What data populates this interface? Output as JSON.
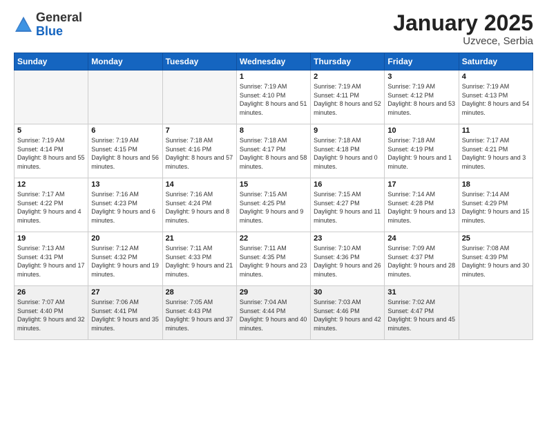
{
  "header": {
    "logo_general": "General",
    "logo_blue": "Blue",
    "title": "January 2025",
    "subtitle": "Uzvece, Serbia"
  },
  "weekdays": [
    "Sunday",
    "Monday",
    "Tuesday",
    "Wednesday",
    "Thursday",
    "Friday",
    "Saturday"
  ],
  "weeks": [
    [
      {
        "day": "",
        "info": ""
      },
      {
        "day": "",
        "info": ""
      },
      {
        "day": "",
        "info": ""
      },
      {
        "day": "1",
        "info": "Sunrise: 7:19 AM\nSunset: 4:10 PM\nDaylight: 8 hours and 51 minutes."
      },
      {
        "day": "2",
        "info": "Sunrise: 7:19 AM\nSunset: 4:11 PM\nDaylight: 8 hours and 52 minutes."
      },
      {
        "day": "3",
        "info": "Sunrise: 7:19 AM\nSunset: 4:12 PM\nDaylight: 8 hours and 53 minutes."
      },
      {
        "day": "4",
        "info": "Sunrise: 7:19 AM\nSunset: 4:13 PM\nDaylight: 8 hours and 54 minutes."
      }
    ],
    [
      {
        "day": "5",
        "info": "Sunrise: 7:19 AM\nSunset: 4:14 PM\nDaylight: 8 hours and 55 minutes."
      },
      {
        "day": "6",
        "info": "Sunrise: 7:19 AM\nSunset: 4:15 PM\nDaylight: 8 hours and 56 minutes."
      },
      {
        "day": "7",
        "info": "Sunrise: 7:18 AM\nSunset: 4:16 PM\nDaylight: 8 hours and 57 minutes."
      },
      {
        "day": "8",
        "info": "Sunrise: 7:18 AM\nSunset: 4:17 PM\nDaylight: 8 hours and 58 minutes."
      },
      {
        "day": "9",
        "info": "Sunrise: 7:18 AM\nSunset: 4:18 PM\nDaylight: 9 hours and 0 minutes."
      },
      {
        "day": "10",
        "info": "Sunrise: 7:18 AM\nSunset: 4:19 PM\nDaylight: 9 hours and 1 minute."
      },
      {
        "day": "11",
        "info": "Sunrise: 7:17 AM\nSunset: 4:21 PM\nDaylight: 9 hours and 3 minutes."
      }
    ],
    [
      {
        "day": "12",
        "info": "Sunrise: 7:17 AM\nSunset: 4:22 PM\nDaylight: 9 hours and 4 minutes."
      },
      {
        "day": "13",
        "info": "Sunrise: 7:16 AM\nSunset: 4:23 PM\nDaylight: 9 hours and 6 minutes."
      },
      {
        "day": "14",
        "info": "Sunrise: 7:16 AM\nSunset: 4:24 PM\nDaylight: 9 hours and 8 minutes."
      },
      {
        "day": "15",
        "info": "Sunrise: 7:15 AM\nSunset: 4:25 PM\nDaylight: 9 hours and 9 minutes."
      },
      {
        "day": "16",
        "info": "Sunrise: 7:15 AM\nSunset: 4:27 PM\nDaylight: 9 hours and 11 minutes."
      },
      {
        "day": "17",
        "info": "Sunrise: 7:14 AM\nSunset: 4:28 PM\nDaylight: 9 hours and 13 minutes."
      },
      {
        "day": "18",
        "info": "Sunrise: 7:14 AM\nSunset: 4:29 PM\nDaylight: 9 hours and 15 minutes."
      }
    ],
    [
      {
        "day": "19",
        "info": "Sunrise: 7:13 AM\nSunset: 4:31 PM\nDaylight: 9 hours and 17 minutes."
      },
      {
        "day": "20",
        "info": "Sunrise: 7:12 AM\nSunset: 4:32 PM\nDaylight: 9 hours and 19 minutes."
      },
      {
        "day": "21",
        "info": "Sunrise: 7:11 AM\nSunset: 4:33 PM\nDaylight: 9 hours and 21 minutes."
      },
      {
        "day": "22",
        "info": "Sunrise: 7:11 AM\nSunset: 4:35 PM\nDaylight: 9 hours and 23 minutes."
      },
      {
        "day": "23",
        "info": "Sunrise: 7:10 AM\nSunset: 4:36 PM\nDaylight: 9 hours and 26 minutes."
      },
      {
        "day": "24",
        "info": "Sunrise: 7:09 AM\nSunset: 4:37 PM\nDaylight: 9 hours and 28 minutes."
      },
      {
        "day": "25",
        "info": "Sunrise: 7:08 AM\nSunset: 4:39 PM\nDaylight: 9 hours and 30 minutes."
      }
    ],
    [
      {
        "day": "26",
        "info": "Sunrise: 7:07 AM\nSunset: 4:40 PM\nDaylight: 9 hours and 32 minutes."
      },
      {
        "day": "27",
        "info": "Sunrise: 7:06 AM\nSunset: 4:41 PM\nDaylight: 9 hours and 35 minutes."
      },
      {
        "day": "28",
        "info": "Sunrise: 7:05 AM\nSunset: 4:43 PM\nDaylight: 9 hours and 37 minutes."
      },
      {
        "day": "29",
        "info": "Sunrise: 7:04 AM\nSunset: 4:44 PM\nDaylight: 9 hours and 40 minutes."
      },
      {
        "day": "30",
        "info": "Sunrise: 7:03 AM\nSunset: 4:46 PM\nDaylight: 9 hours and 42 minutes."
      },
      {
        "day": "31",
        "info": "Sunrise: 7:02 AM\nSunset: 4:47 PM\nDaylight: 9 hours and 45 minutes."
      },
      {
        "day": "",
        "info": ""
      }
    ]
  ]
}
